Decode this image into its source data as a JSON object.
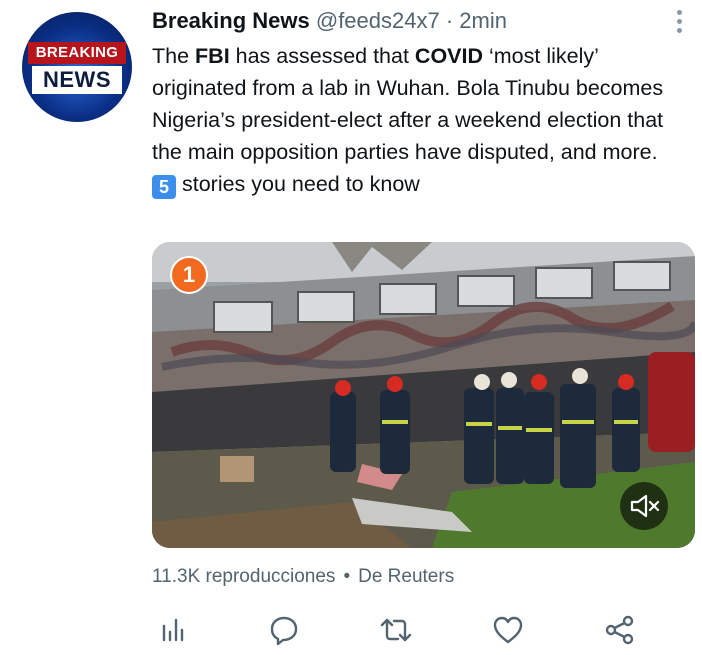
{
  "avatar": {
    "line1": "BREAKING",
    "line2": "NEWS",
    "colors": {
      "bg": "#0a2f86",
      "red": "#b8141c"
    }
  },
  "tweet": {
    "author_name": "Breaking News",
    "handle": "@feeds24x7",
    "separator": "·",
    "time": "2min",
    "text": {
      "p1": "The ",
      "b1": "FBI",
      "p2": " has assessed that ",
      "b2": "COVID",
      "p3": " ‘most likely’ originated from a lab in Wuhan. Bola Tinubu becomes Nigeria’s president-elect after a weekend election that the main opposition parties have disputed, and more. ",
      "emoji": "5",
      "p4": " stories you need to know"
    },
    "media": {
      "badge_number": "1",
      "mute_icon": "speaker-muted-icon"
    },
    "stats": {
      "views": "11.3K reproducciones",
      "dot": "•",
      "source": "De Reuters"
    }
  },
  "actions": [
    {
      "icon": "analytics-icon"
    },
    {
      "icon": "reply-icon"
    },
    {
      "icon": "retweet-icon"
    },
    {
      "icon": "like-icon"
    },
    {
      "icon": "share-icon"
    }
  ],
  "colors": {
    "text": "#0f1419",
    "secondary": "#536471",
    "emoji_bg": "#3b8eea",
    "badge": "#f26a1f"
  }
}
